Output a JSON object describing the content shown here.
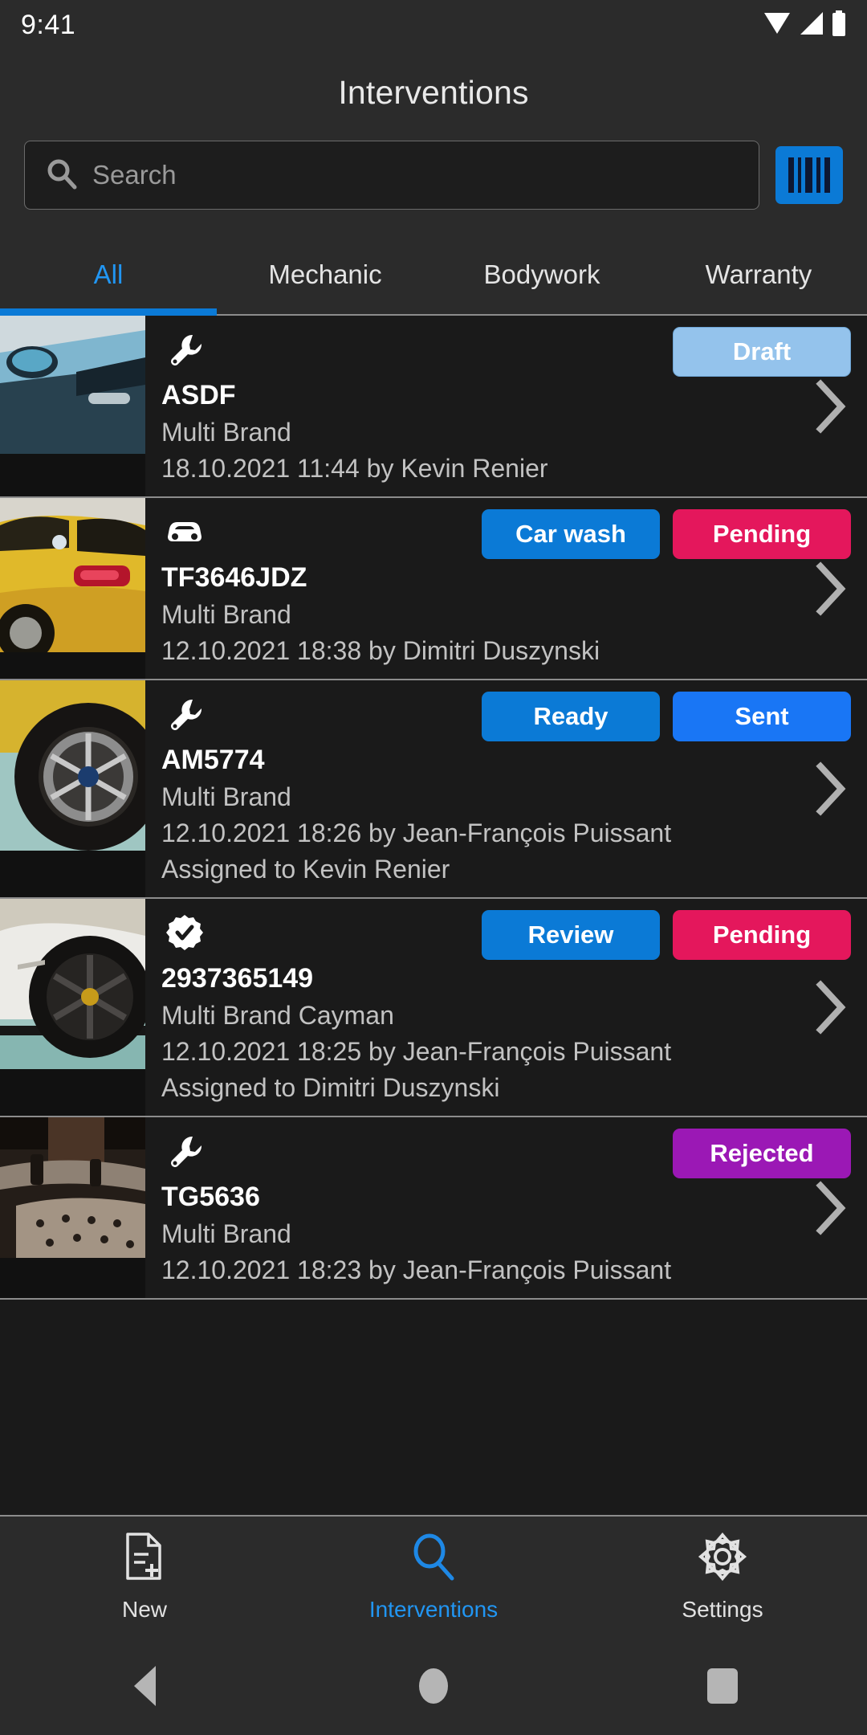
{
  "status_bar": {
    "time": "9:41",
    "icons": [
      "wifi-icon",
      "signal-icon",
      "battery-icon"
    ]
  },
  "header": {
    "title": "Interventions"
  },
  "search": {
    "placeholder": "Search",
    "value": "",
    "icon": "search-icon",
    "scan_button_icon": "barcode-scan-icon",
    "scan_button_color": "#0b7ad6"
  },
  "tabs": {
    "active_index": 0,
    "active_color": "#2196f3",
    "items": [
      {
        "label": "All"
      },
      {
        "label": "Mechanic"
      },
      {
        "label": "Bodywork"
      },
      {
        "label": "Warranty"
      }
    ]
  },
  "list": {
    "items": [
      {
        "icon": "wrench-icon",
        "title": "ASDF",
        "subtitle": "Multi Brand",
        "meta": "18.10.2021 11:44 by Kevin Renier",
        "assigned": "",
        "badges": [
          {
            "label": "Draft",
            "style": "draft",
            "color": "#94c3ec"
          }
        ],
        "thumbnail": "car-door-mirror-photo"
      },
      {
        "icon": "car-icon",
        "title": "TF3646JDZ",
        "subtitle": "Multi Brand",
        "meta": "12.10.2021 18:38 by Dimitri Duszynski",
        "assigned": "",
        "badges": [
          {
            "label": "Car wash",
            "style": "blue",
            "color": "#0b7ad6"
          },
          {
            "label": "Pending",
            "style": "pink",
            "color": "#e4175c"
          }
        ],
        "thumbnail": "yellow-car-rear-photo"
      },
      {
        "icon": "wrench-icon",
        "title": "AM5774",
        "subtitle": "Multi Brand",
        "meta": "12.10.2021 18:26 by Jean-François Puissant",
        "assigned": "Assigned to Kevin Renier",
        "badges": [
          {
            "label": "Ready",
            "style": "blue",
            "color": "#0b7ad6"
          },
          {
            "label": "Sent",
            "style": "bright",
            "color": "#1976f5"
          }
        ],
        "thumbnail": "yellow-car-wheel-photo"
      },
      {
        "icon": "verified-check-icon",
        "title": "2937365149",
        "subtitle": "Multi Brand Cayman",
        "meta": "12.10.2021 18:25 by Jean-François Puissant",
        "assigned": "Assigned to Dimitri Duszynski",
        "badges": [
          {
            "label": "Review",
            "style": "blue",
            "color": "#0b7ad6"
          },
          {
            "label": "Pending",
            "style": "pink",
            "color": "#e4175c"
          }
        ],
        "thumbnail": "white-car-wheel-photo"
      },
      {
        "icon": "wrench-icon",
        "title": "TG5636",
        "subtitle": "Multi Brand",
        "meta": "12.10.2021 18:23 by Jean-François Puissant",
        "assigned": "",
        "badges": [
          {
            "label": "Rejected",
            "style": "purple",
            "color": "#9b18b5"
          }
        ],
        "thumbnail": "brake-disc-photo"
      }
    ],
    "chevron_icon": "chevron-right-icon"
  },
  "bottom_nav": {
    "active_index": 1,
    "active_color": "#2196f3",
    "items": [
      {
        "label": "New",
        "icon": "new-document-icon"
      },
      {
        "label": "Interventions",
        "icon": "search-icon"
      },
      {
        "label": "Settings",
        "icon": "gear-icon"
      }
    ]
  },
  "system_nav": {
    "back": "back-triangle-icon",
    "home": "home-circle-icon",
    "recents": "recents-square-icon"
  }
}
